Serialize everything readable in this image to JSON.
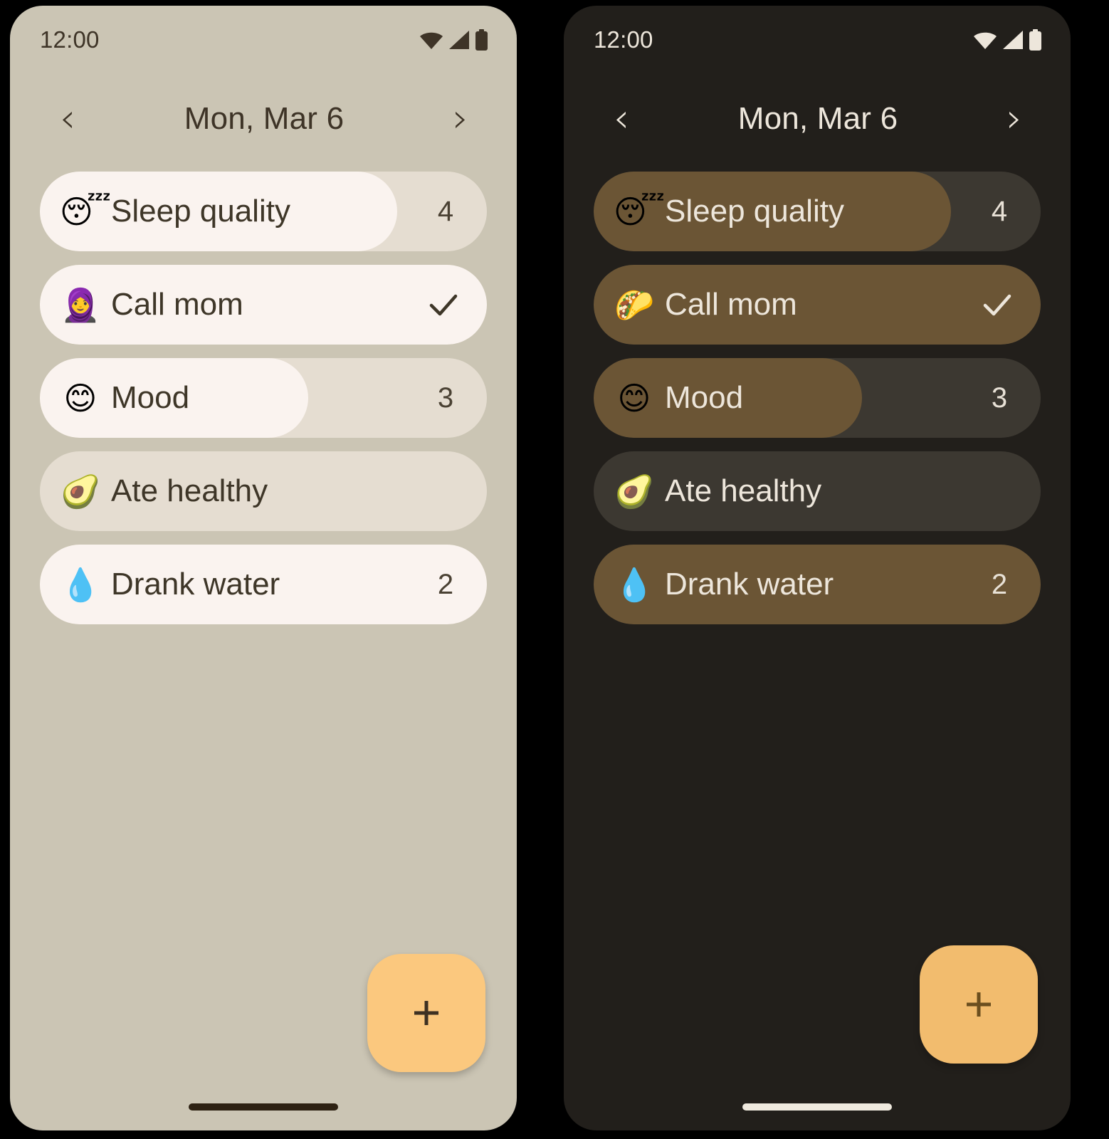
{
  "themes": [
    {
      "id": "light",
      "statusbar": {
        "time": "12:00",
        "wifi_icon": "wifi-icon",
        "signal_icon": "cellular-signal-icon",
        "battery_icon": "battery-icon"
      },
      "header": {
        "prev_label": "‹",
        "title": "Mon, Mar 6",
        "next_label": "›"
      },
      "habits": [
        {
          "emoji": "😴",
          "emoji_name": "sleeping-face-emoji",
          "name": "Sleep quality",
          "value": "4",
          "type": "value",
          "progress_pct": 80
        },
        {
          "emoji": "🧕",
          "emoji_name": "woman-with-headscarf-emoji",
          "name": "Call mom",
          "value": "✓",
          "type": "check",
          "progress_pct": 100
        },
        {
          "emoji": "😊",
          "emoji_name": "smiling-face-emoji",
          "name": "Mood",
          "value": "3",
          "type": "value",
          "progress_pct": 60
        },
        {
          "emoji": "🥑",
          "emoji_name": "avocado-emoji",
          "name": "Ate healthy",
          "value": "",
          "type": "none",
          "progress_pct": 0
        },
        {
          "emoji": "💧",
          "emoji_name": "droplet-emoji",
          "name": "Drank water",
          "value": "2",
          "type": "value",
          "progress_pct": 100
        }
      ],
      "fab": {
        "label": "+",
        "name": "add-habit-button"
      },
      "colors": {
        "background": "#CBC5B4",
        "track": "#E5DDD1",
        "fill": "#FAF3EF",
        "text": "#3E3628",
        "accent": "#FBC87E"
      }
    },
    {
      "id": "dark",
      "statusbar": {
        "time": "12:00",
        "wifi_icon": "wifi-icon",
        "signal_icon": "cellular-signal-icon",
        "battery_icon": "battery-icon"
      },
      "header": {
        "prev_label": "‹",
        "title": "Mon, Mar 6",
        "next_label": "›"
      },
      "habits": [
        {
          "emoji": "😴",
          "emoji_name": "sleeping-face-emoji",
          "name": "Sleep quality",
          "value": "4",
          "type": "value",
          "progress_pct": 80
        },
        {
          "emoji": "🌮",
          "emoji_name": "taco-emoji",
          "name": "Call mom",
          "value": "✓",
          "type": "check",
          "progress_pct": 100
        },
        {
          "emoji": "😊",
          "emoji_name": "smiling-face-emoji",
          "name": "Mood",
          "value": "3",
          "type": "value",
          "progress_pct": 60
        },
        {
          "emoji": "🥑",
          "emoji_name": "avocado-emoji",
          "name": "Ate healthy",
          "value": "",
          "type": "none",
          "progress_pct": 0
        },
        {
          "emoji": "💧",
          "emoji_name": "droplet-emoji",
          "name": "Drank water",
          "value": "2",
          "type": "value",
          "progress_pct": 100
        }
      ],
      "fab": {
        "label": "+",
        "name": "add-habit-button"
      },
      "colors": {
        "background": "#221F1B",
        "track": "#3C3831",
        "fill": "#6B5535",
        "text": "#EDE6DB",
        "accent": "#F2BC6E"
      }
    }
  ]
}
